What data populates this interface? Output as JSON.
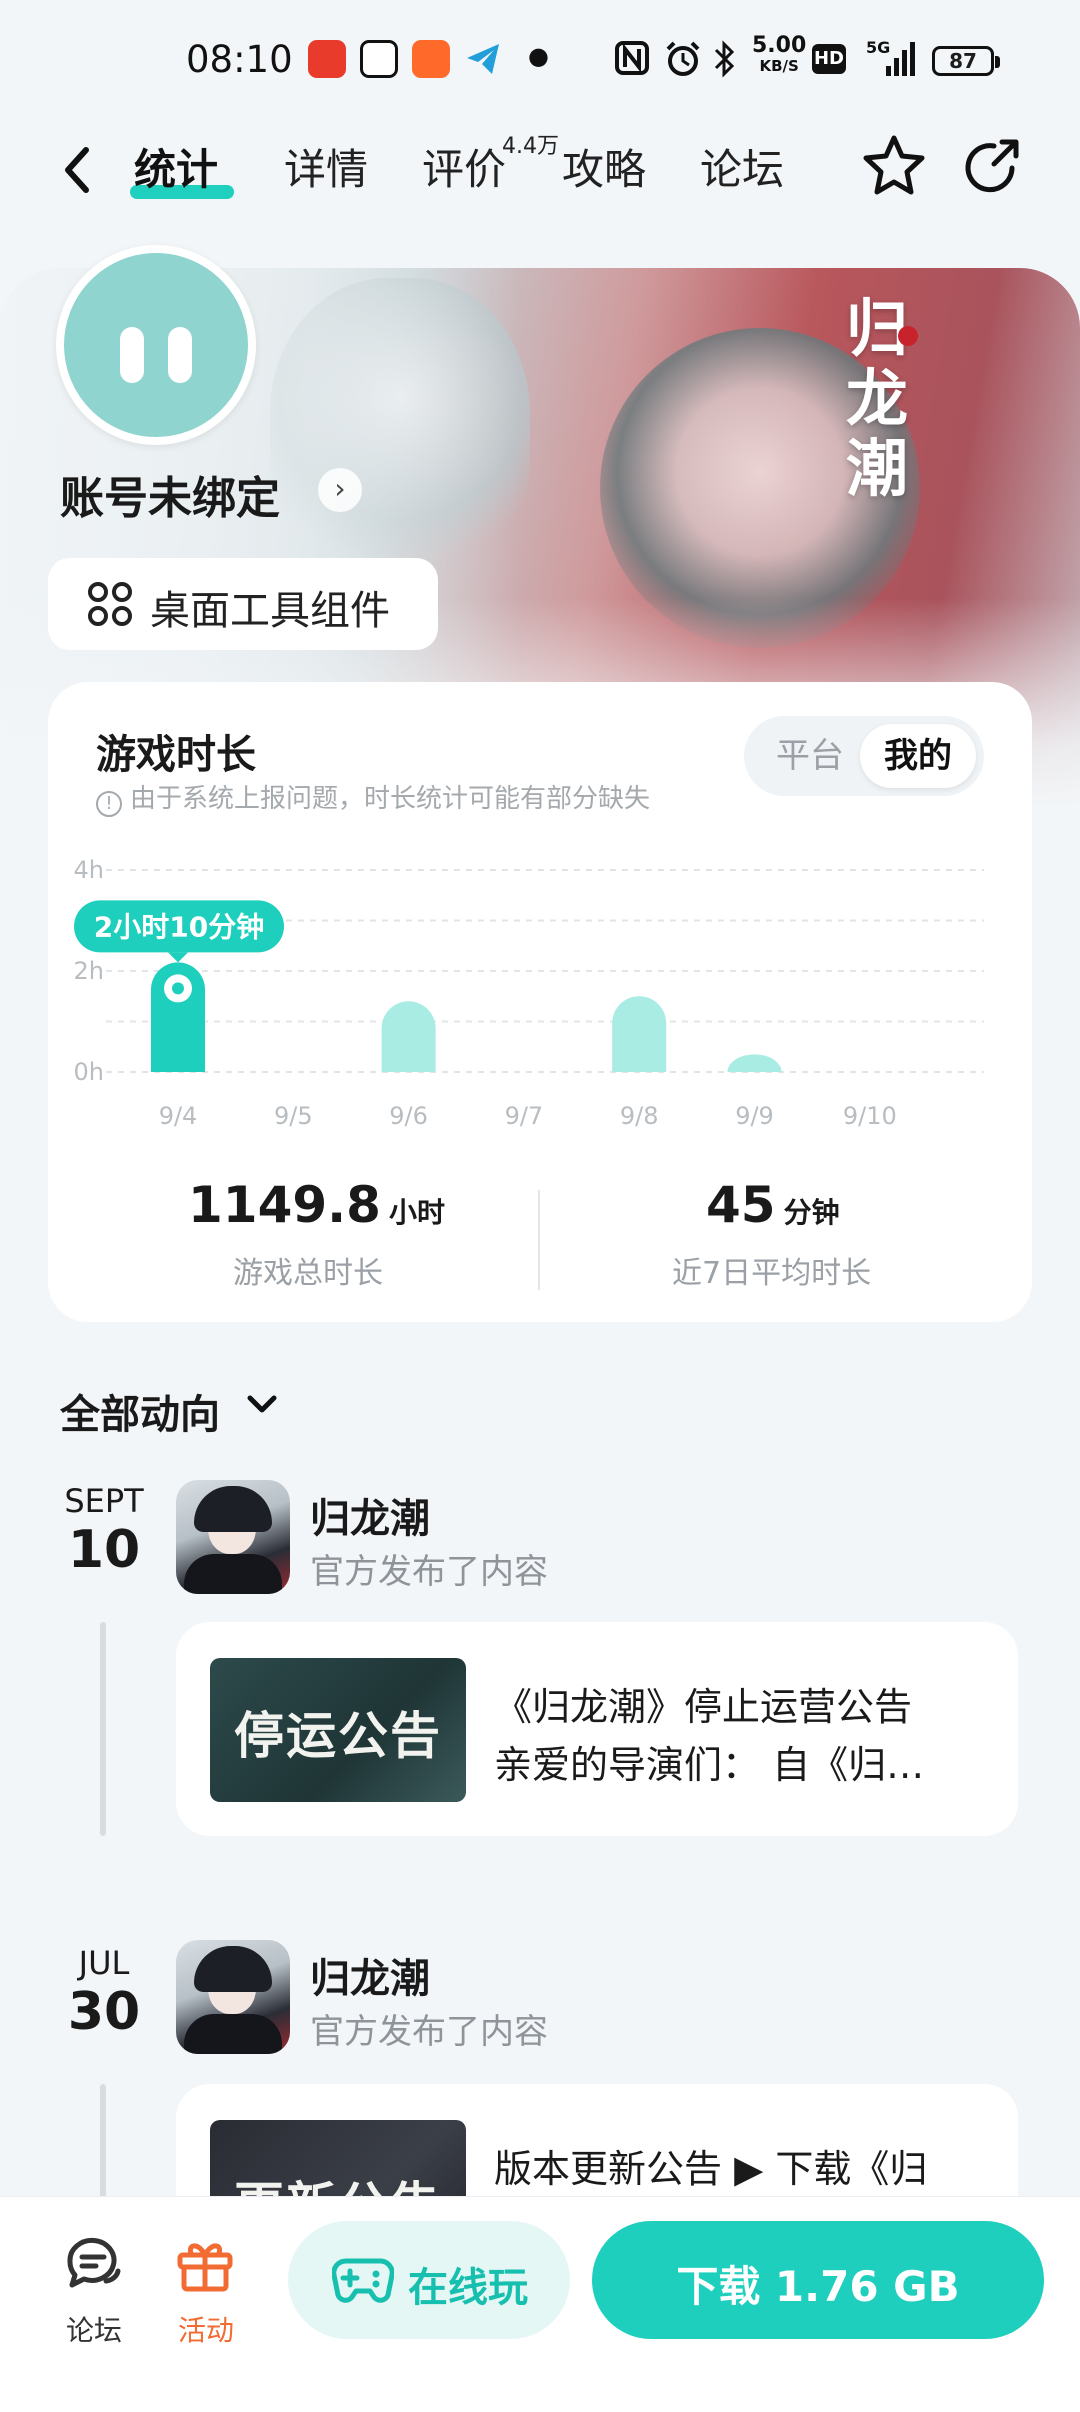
{
  "status_bar": {
    "time": "08:10",
    "net_speed_value": "5.00",
    "net_speed_unit": "KB/S",
    "hd": "HD",
    "signal": "5G",
    "battery": "87"
  },
  "nav": {
    "tabs": [
      {
        "label": "统计",
        "active": true
      },
      {
        "label": "详情",
        "active": false
      },
      {
        "label": "评价",
        "active": false
      },
      {
        "label": "攻略",
        "active": false
      },
      {
        "label": "论坛",
        "active": false
      }
    ],
    "review_badge": "4.4万"
  },
  "banner": {
    "logo_text": "归龙潮"
  },
  "account": {
    "name": "账号未绑定",
    "widget_button": "桌面工具组件"
  },
  "stats": {
    "title": "游戏时长",
    "note": "由于系统上报问题，时长统计可能有部分缺失",
    "toggle": {
      "platform": "平台",
      "mine": "我的"
    },
    "total_value": "1149.8",
    "total_unit": "小时",
    "total_label": "游戏总时长",
    "avg_value": "45",
    "avg_unit": "分钟",
    "avg_label": "近7日平均时长"
  },
  "chart_data": {
    "type": "bar",
    "categories": [
      "9/4",
      "9/5",
      "9/6",
      "9/7",
      "9/8",
      "9/9",
      "9/10"
    ],
    "values": [
      2.17,
      0,
      1.4,
      0,
      1.5,
      0.35,
      0
    ],
    "y_ticks": [
      "0h",
      "2h",
      "4h"
    ],
    "ylim": [
      0,
      4
    ],
    "grid": true,
    "tooltip": {
      "index": 0,
      "text": "2小时10分钟"
    },
    "colors": {
      "selected": "#1fcfbd",
      "normal": "#a9ece4"
    }
  },
  "feed": {
    "filter_label": "全部动向",
    "entries": [
      {
        "month": "SEPT",
        "day": "10",
        "name": "归龙潮",
        "action": "官方发布了内容",
        "thumb_text": "停运公告",
        "title": "《归龙潮》停止运营公告",
        "excerpt": "亲爱的导演们： 自《归…"
      },
      {
        "month": "JUL",
        "day": "30",
        "name": "归龙潮",
        "action": "官方发布了内容",
        "thumb_text": "更新公告",
        "title": "版本更新公告 ▶ 下载《归",
        "excerpt": ""
      }
    ]
  },
  "bottom_bar": {
    "forum_label": "论坛",
    "event_label": "活动",
    "play_label": "在线玩",
    "download_label": "下载 1.76 GB"
  },
  "colors": {
    "accent": "#1fcfbd",
    "accent_light": "#e5f7f5",
    "event_orange": "#f26b33"
  }
}
